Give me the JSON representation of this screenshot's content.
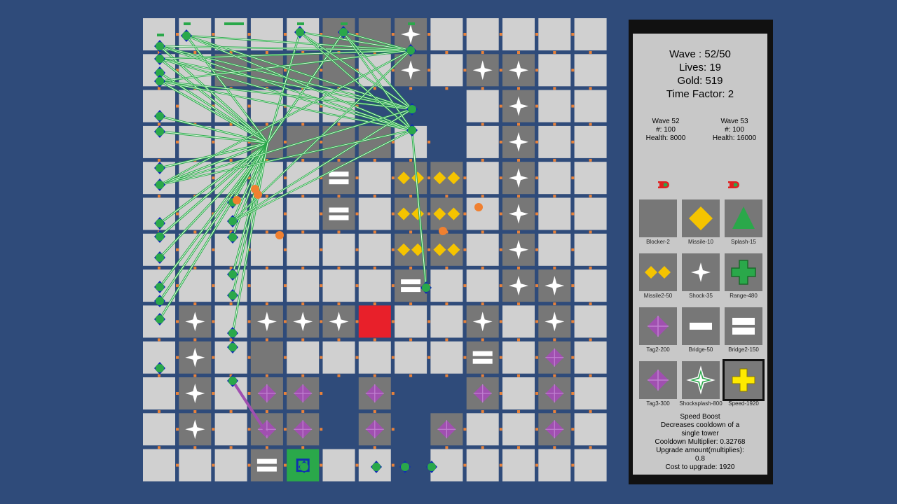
{
  "stats": {
    "wave": "Wave : 52/50",
    "lives": "Lives: 19",
    "gold": "Gold: 519",
    "time_factor": "Time Factor: 2"
  },
  "waves": [
    {
      "title": "Wave 52",
      "count": "#: 100",
      "health": "Health: 8000"
    },
    {
      "title": "Wave 53",
      "count": "#: 100",
      "health": "Health: 16000"
    }
  ],
  "towers": [
    {
      "label": "Blocker-2",
      "icon": "blocker-icon"
    },
    {
      "label": "Missile-10",
      "icon": "missile-icon"
    },
    {
      "label": "Splash-15",
      "icon": "splash-icon"
    },
    {
      "label": "Missile2-50",
      "icon": "missile2-icon"
    },
    {
      "label": "Shock-35",
      "icon": "shock-icon"
    },
    {
      "label": "Range-480",
      "icon": "range-icon"
    },
    {
      "label": "Tag2-200",
      "icon": "tag2-icon"
    },
    {
      "label": "Bridge-50",
      "icon": "bridge-icon"
    },
    {
      "label": "Bridge2-150",
      "icon": "bridge2-icon"
    },
    {
      "label": "Tag3-300",
      "icon": "tag3-icon"
    },
    {
      "label": "Shocksplash-800",
      "icon": "shocksplash-icon"
    },
    {
      "label": "Speed-1920",
      "icon": "speed-icon"
    }
  ],
  "selected_tower": "Speed-1920",
  "description": {
    "title": "Speed Boost",
    "line1": "Decreases cooldown of a",
    "line2": "single tower",
    "line3": "Cooldown Multiplier: 0.32768",
    "line4": "Upgrade amount(multiplies):",
    "line5": "0.8",
    "line6": "Cost to upgrade: 1920"
  },
  "colors": {
    "background": "#2f4b7a",
    "empty_tile": "#d0d0d0",
    "tower_tile": "#777777",
    "goal_tile": "#e8202a",
    "spawn_tile": "#2aa84a",
    "missile": "#f5c400",
    "tag": "#a050b0",
    "range": "#2aa84a",
    "enemy": "#2aa84a",
    "bullet": "#f08030"
  }
}
